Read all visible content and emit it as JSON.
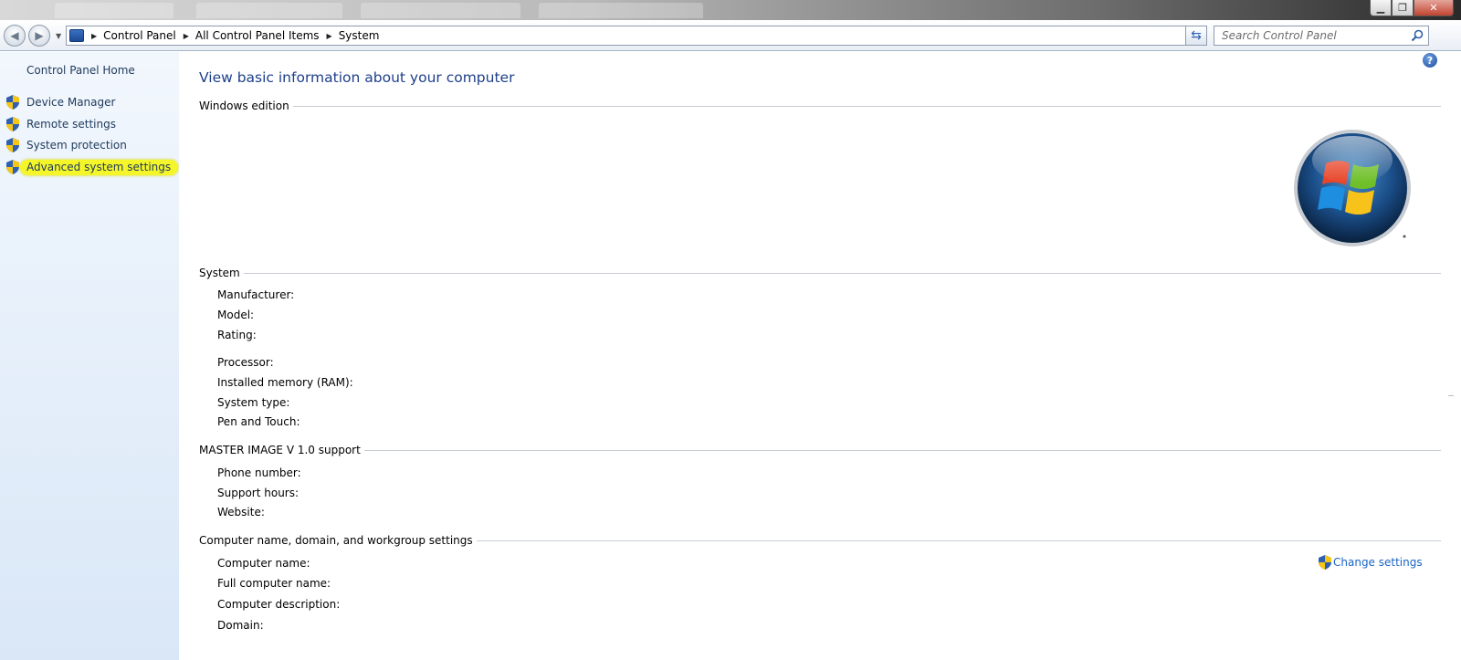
{
  "navbar": {
    "breadcrumbs": [
      "Control Panel",
      "All Control Panel Items",
      "System"
    ],
    "search_placeholder": "Search Control Panel"
  },
  "left_pane": {
    "home_label": "Control Panel Home",
    "items": [
      {
        "label": "Device Manager",
        "icon": "shield-icon",
        "highlighted": false
      },
      {
        "label": "Remote settings",
        "icon": "shield-icon",
        "highlighted": false
      },
      {
        "label": "System protection",
        "icon": "shield-icon",
        "highlighted": false
      },
      {
        "label": "Advanced system settings",
        "icon": "shield-icon",
        "highlighted": true
      }
    ]
  },
  "main": {
    "title": "View basic information about your computer",
    "sections": {
      "windows_edition": "Windows edition",
      "system": "System",
      "support": "MASTER IMAGE V 1.0 support",
      "computer_name": "Computer name, domain, and workgroup settings"
    },
    "system_fields": [
      "Manufacturer:",
      "Model:",
      "Rating:",
      "Processor:",
      "Installed memory (RAM):",
      "System type:",
      "Pen and Touch:"
    ],
    "support_fields": [
      "Phone number:",
      "Support hours:",
      "Website:"
    ],
    "computer_fields": [
      "Computer name:",
      "Full computer name:",
      "Computer description:",
      "Domain:"
    ],
    "change_settings_label": "Change settings"
  },
  "colors": {
    "link": "#1b64c4",
    "title": "#1e3f8a",
    "nav_text": "#1e395b",
    "highlight": "#f5f62a"
  }
}
